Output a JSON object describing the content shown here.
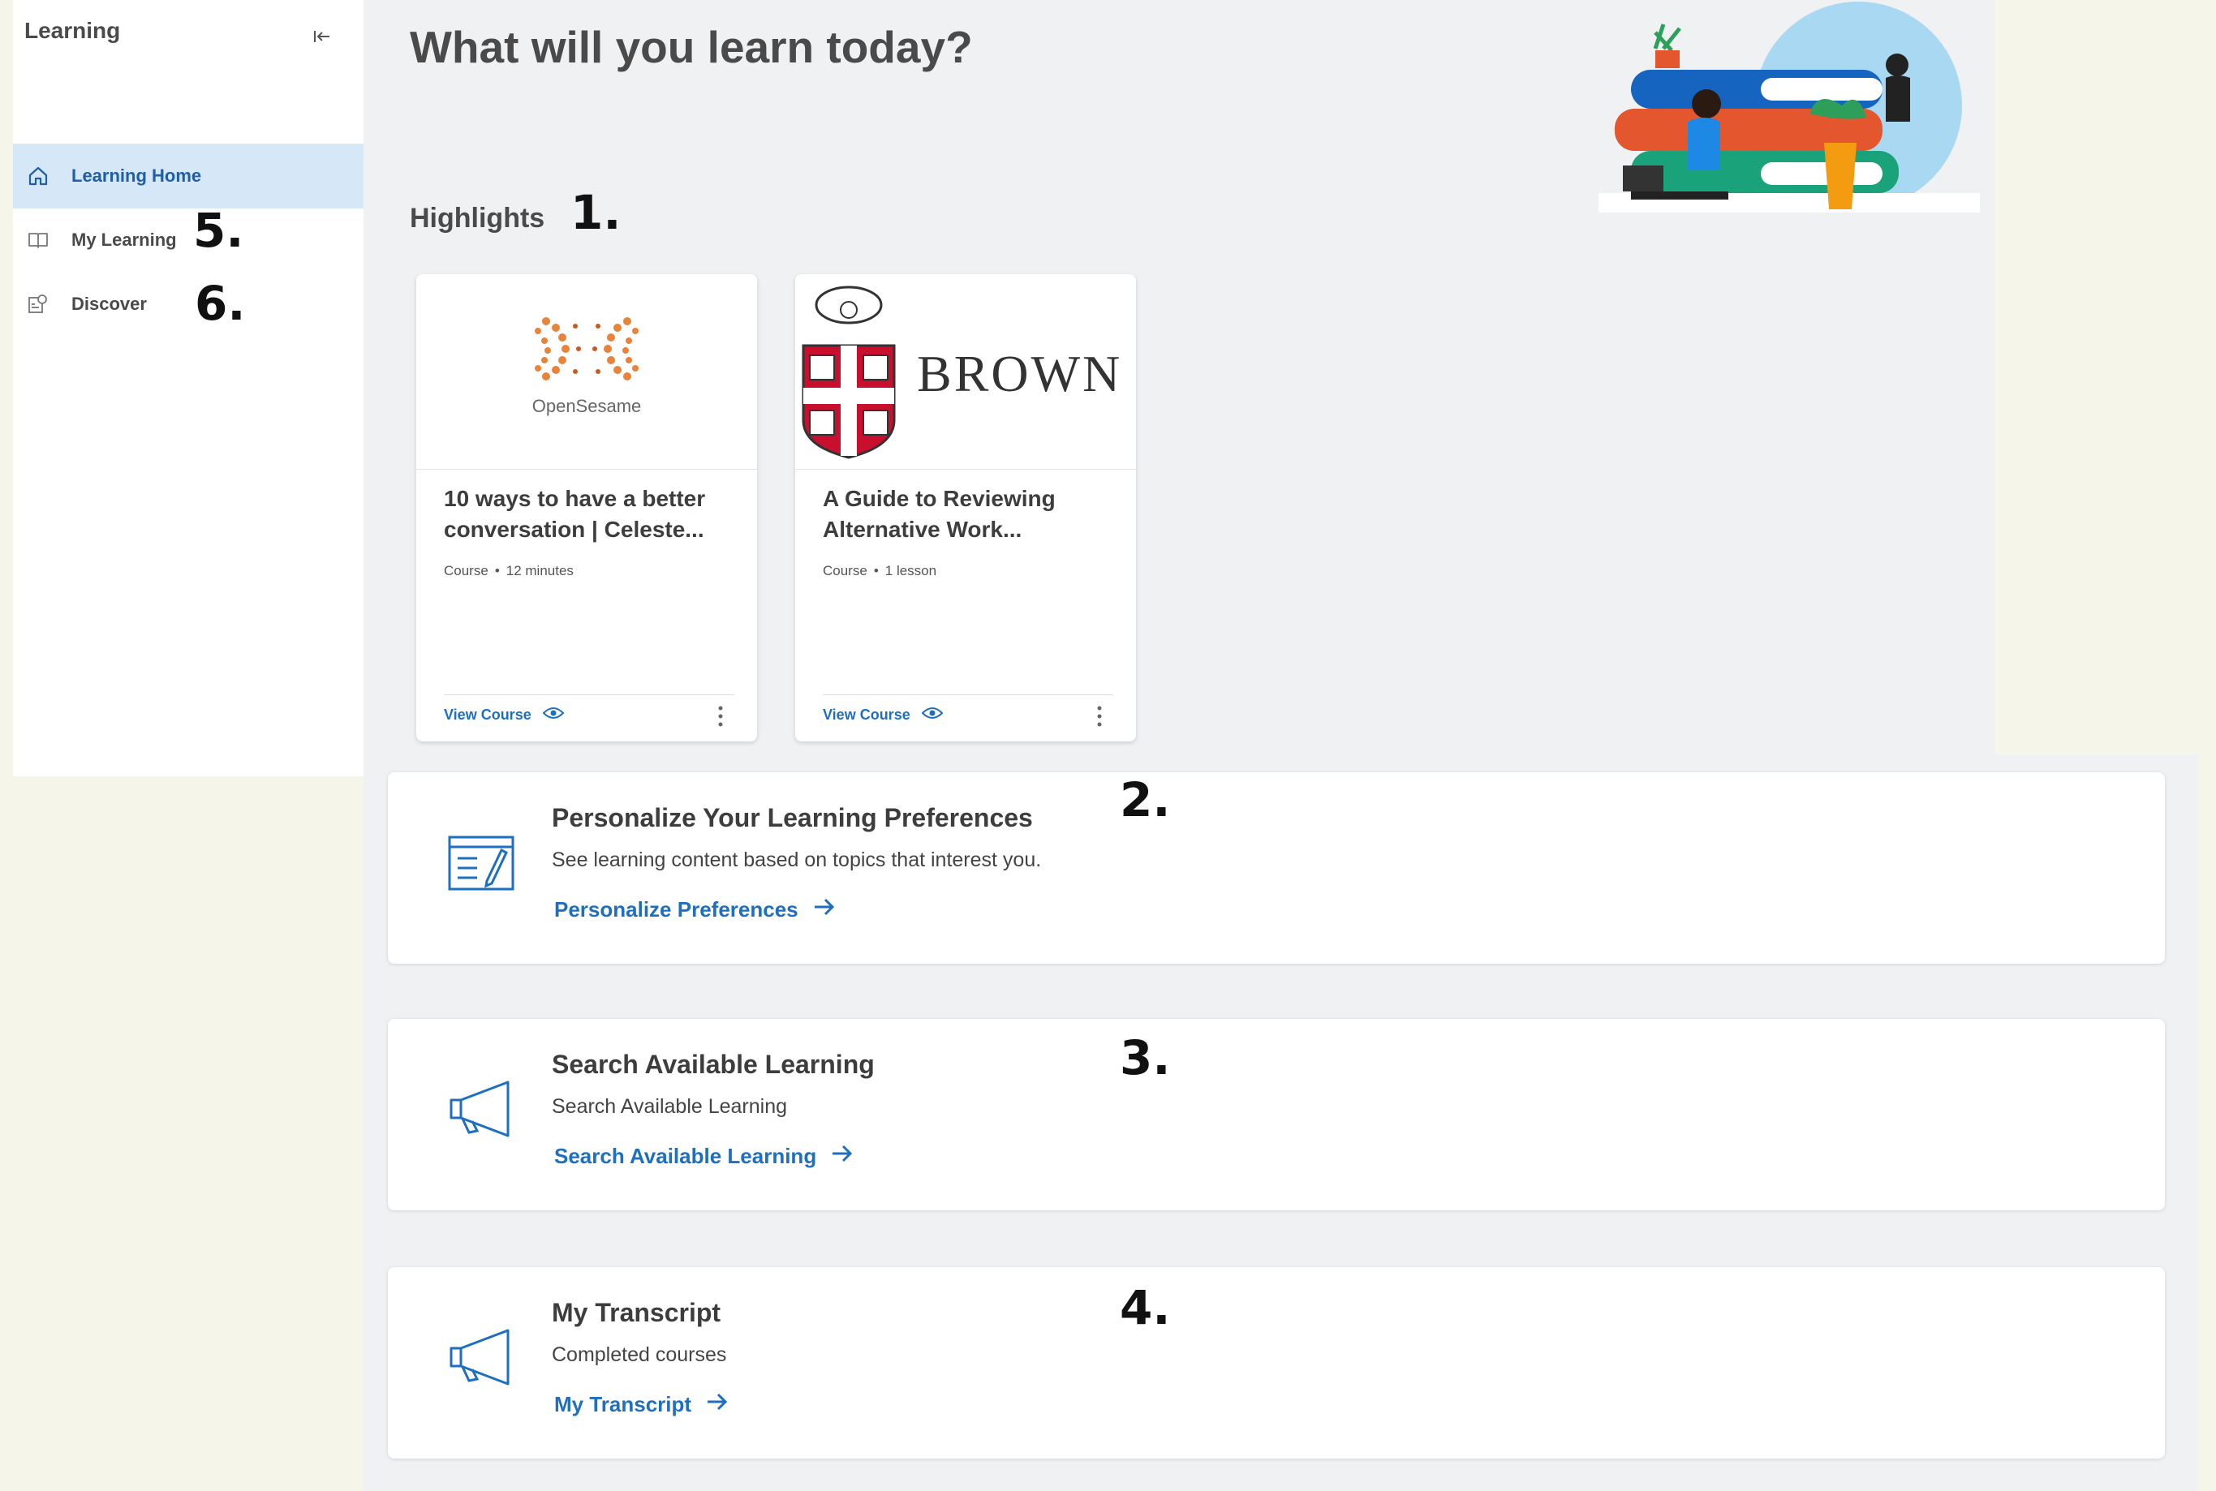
{
  "sidebar": {
    "title": "Learning",
    "items": [
      {
        "label": "Learning Home",
        "icon": "home-icon",
        "active": true
      },
      {
        "label": "My Learning",
        "icon": "book-icon",
        "active": false
      },
      {
        "label": "Discover",
        "icon": "discover-icon",
        "active": false
      }
    ]
  },
  "main": {
    "title": "What will you learn today?",
    "highlights_title": "Highlights",
    "cards": [
      {
        "provider_logo_text": "OpenSesame",
        "title": "10 ways to have a better conversation | Celeste...",
        "type": "Course",
        "duration": "12 minutes",
        "link": "View Course"
      },
      {
        "provider_logo_text": "BROWN",
        "title": "A Guide to Reviewing Alternative Work...",
        "type": "Course",
        "duration": "1 lesson",
        "link": "View Course"
      }
    ]
  },
  "panels": [
    {
      "title": "Personalize Your Learning Preferences",
      "description": "See learning content based on topics that interest you.",
      "link": "Personalize Preferences",
      "icon": "edit-document-icon"
    },
    {
      "title": "Search Available Learning",
      "description": "Search Available Learning",
      "link": "Search Available Learning",
      "icon": "megaphone-icon"
    },
    {
      "title": "My Transcript",
      "description": "Completed courses",
      "link": "My Transcript",
      "icon": "megaphone-icon"
    }
  ],
  "annotations": {
    "m1": "1.",
    "m2": "2.",
    "m3": "3.",
    "m4": "4.",
    "m5": "5.",
    "m6": "6."
  },
  "colors": {
    "accent": "#1f6fc0",
    "active_nav_bg": "#d6e8f8",
    "page_bg": "#eff1f3",
    "outer_bg": "#f5f5ea"
  }
}
